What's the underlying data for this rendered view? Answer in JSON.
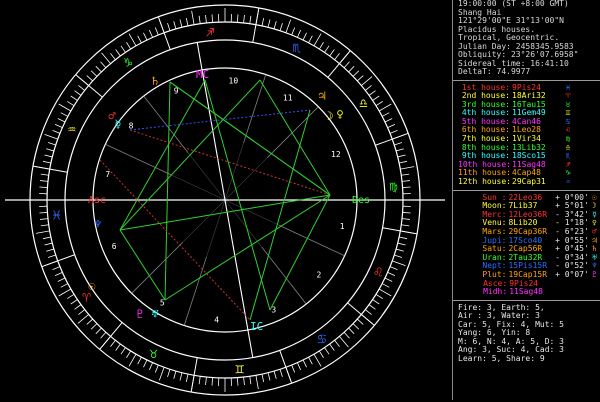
{
  "header_lines": [
    "19:00:00 (ST +8:00 GMT)",
    "Shang Hai",
    "121°29'00\"E 31°13'00\"N",
    "Placidus houses.",
    "Tropical, Geocentric.",
    "Julian Day: 2458345.9583",
    "Obliquity: 23°26'07.6958\"",
    "Sidereal time: 16:41:10",
    "DeltaT: 74.9977"
  ],
  "houses": [
    {
      "label": "1st house:",
      "value": "9Pis24",
      "color": "#ff3030",
      "glyph": "♓",
      "glyph_color": "#2a6cff"
    },
    {
      "label": "2nd house:",
      "value": "18Ari32",
      "color": "#ffff30",
      "glyph": "♈",
      "glyph_color": "#ff3030"
    },
    {
      "label": "3rd house:",
      "value": "16Tau15",
      "color": "#30ff30",
      "glyph": "♉",
      "glyph_color": "#30ff30"
    },
    {
      "label": "4th house:",
      "value": "11Gem49",
      "color": "#30ffff",
      "glyph": "♊",
      "glyph_color": "#ffff30"
    },
    {
      "label": "5th house:",
      "value": "4Can46",
      "color": "#ff30ff",
      "glyph": "♋",
      "glyph_color": "#2a6cff"
    },
    {
      "label": "6th house:",
      "value": "1Leo28",
      "color": "#ffa500",
      "glyph": "♌",
      "glyph_color": "#ff3030"
    },
    {
      "label": "7th house:",
      "value": "1Vir34",
      "color": "#ffff30",
      "glyph": "♍",
      "glyph_color": "#30ff30"
    },
    {
      "label": "8th house:",
      "value": "13Lib32",
      "color": "#30ff30",
      "glyph": "♎",
      "glyph_color": "#ffff30"
    },
    {
      "label": "9th house:",
      "value": "18Sco15",
      "color": "#30ffff",
      "glyph": "♏",
      "glyph_color": "#2a6cff"
    },
    {
      "label": "10th house:",
      "value": "11Sag48",
      "color": "#ff30ff",
      "glyph": "♐",
      "glyph_color": "#ff3030"
    },
    {
      "label": "11th house:",
      "value": "4Cap48",
      "color": "#ffa500",
      "glyph": "♑",
      "glyph_color": "#30ff30"
    },
    {
      "label": "12th house:",
      "value": "29Cap31",
      "color": "#ffff30",
      "glyph": "♒",
      "glyph_color": "#2a6cff"
    }
  ],
  "planets": [
    {
      "label": "Sun :",
      "value": "22Leo36",
      "ext": "+ 0°00'",
      "color": "#ff3030",
      "glyph": "☉",
      "glyph_color": "#ffa500"
    },
    {
      "label": "Moon:",
      "value": "7Lib37",
      "ext": "+ 5°01'",
      "color": "#ffff30",
      "glyph": "☽",
      "glyph_color": "#ffff30"
    },
    {
      "label": "Merc:",
      "value": "12Leo36R",
      "ext": "- 3°42'",
      "color": "#ff3030",
      "glyph": "☿",
      "glyph_color": "#30ffff"
    },
    {
      "label": "Venu:",
      "value": "8Lib20",
      "ext": "- 1°18'",
      "color": "#ffff30",
      "glyph": "♀",
      "glyph_color": "#ffff30"
    },
    {
      "label": "Mars:",
      "value": "29Cap36R",
      "ext": "- 6°23'",
      "color": "#ffa500",
      "glyph": "♂",
      "glyph_color": "#ff3030"
    },
    {
      "label": "Jupi:",
      "value": "17Sco40",
      "ext": "+ 0°55'",
      "color": "#2a6cff",
      "glyph": "♃",
      "glyph_color": "#ffa500"
    },
    {
      "label": "Satu:",
      "value": "2Cap56R",
      "ext": "+ 0°45'",
      "color": "#ffa500",
      "glyph": "♄",
      "glyph_color": "#ffa500"
    },
    {
      "label": "Uran:",
      "value": "2Tau32R",
      "ext": "- 0°34'",
      "color": "#30ff30",
      "glyph": "♅",
      "glyph_color": "#30ffff"
    },
    {
      "label": "Nept:",
      "value": "15Pis15R",
      "ext": "- 0°52'",
      "color": "#2a6cff",
      "glyph": "♆",
      "glyph_color": "#2a6cff"
    },
    {
      "label": "Plut:",
      "value": "19Cap15R",
      "ext": "+ 0°07'",
      "color": "#ffa500",
      "glyph": "♇",
      "glyph_color": "#ff30ff"
    },
    {
      "label": "Asce:",
      "value": "9Pis24",
      "ext": "",
      "color": "#ff3030",
      "glyph": "",
      "glyph_color": "#ffffff"
    },
    {
      "label": "Midh:",
      "value": "11Sag48",
      "ext": "",
      "color": "#ff30ff",
      "glyph": "",
      "glyph_color": "#ffffff"
    }
  ],
  "stats": [
    "Fire: 3, Earth: 5,",
    "Air : 3, Water: 3",
    "Car: 5, Fix: 4, Mut: 5",
    "Yang: 6, Yin: 8",
    "M: 6, N: 4, A: 5, D: 3",
    "Ang: 3, Suc: 4, Cad: 3",
    "Learn: 5, Share: 9"
  ],
  "wheel": {
    "sign_glyphs": [
      "♈",
      "♉",
      "♊",
      "♋",
      "♌",
      "♍",
      "♎",
      "♏",
      "♐",
      "♑",
      "♒",
      "♓"
    ],
    "sign_colors": [
      "#ff3030",
      "#30ff30",
      "#ffff30",
      "#2a6cff",
      "#ff3030",
      "#30ff30",
      "#ffff30",
      "#2a6cff",
      "#ff3030",
      "#30ff30",
      "#ffff30",
      "#2a6cff"
    ],
    "asc_label": "Asc",
    "des_label": "Des",
    "mc_label": "MC",
    "ic_label": "IC",
    "house_numbers": [
      "1",
      "2",
      "3",
      "4",
      "5",
      "6",
      "7",
      "8",
      "9",
      "10",
      "11",
      "12"
    ]
  }
}
